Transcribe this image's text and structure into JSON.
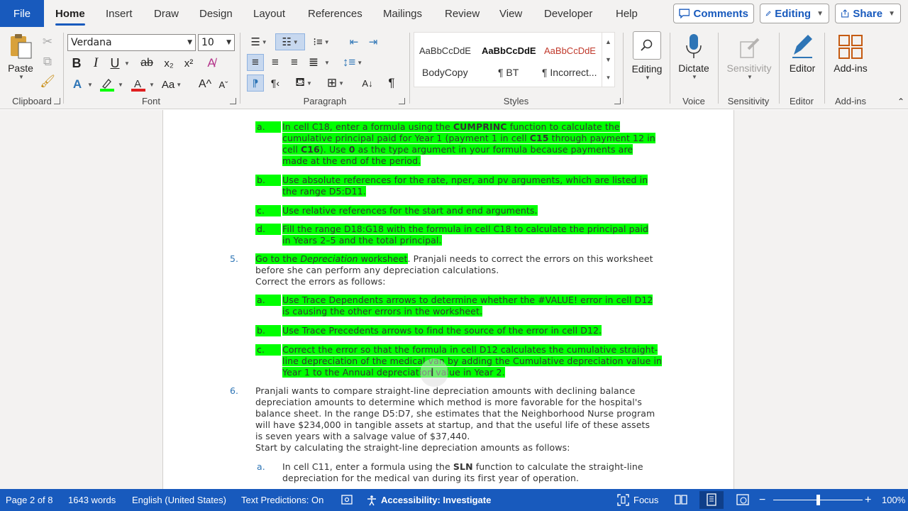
{
  "tabs": {
    "file": "File",
    "items": [
      "Home",
      "Insert",
      "Draw",
      "Design",
      "Layout",
      "References",
      "Mailings",
      "Review",
      "View",
      "Developer",
      "Help"
    ],
    "active": "Home"
  },
  "top_buttons": {
    "comments": "Comments",
    "editing": "Editing",
    "share": "Share"
  },
  "ribbon": {
    "clipboard": {
      "label": "Clipboard",
      "paste": "Paste"
    },
    "font": {
      "label": "Font",
      "name": "Verdana",
      "size": "10",
      "bold": "B",
      "italic": "I",
      "underline": "U",
      "strike": "ab",
      "sub": "x₂",
      "sup": "x²",
      "grow": "A^",
      "shrink": "Aa"
    },
    "paragraph": {
      "label": "Paragraph"
    },
    "styles": {
      "label": "Styles",
      "items": [
        {
          "preview": "AaBbCcDdE",
          "name": "BodyCopy"
        },
        {
          "preview": "AaBbCcDdE",
          "name": "¶ BT"
        },
        {
          "preview": "AaBbCcDdE",
          "name": "¶ Incorrect..."
        }
      ]
    },
    "editing": {
      "label": "Editing"
    },
    "voice": {
      "label": "Voice",
      "button": "Dictate"
    },
    "sensitivity": {
      "label": "Sensitivity",
      "button": "Sensitivity"
    },
    "editor": {
      "label": "Editor",
      "button": "Editor"
    },
    "addins": {
      "label": "Add-ins",
      "button": "Add-ins"
    }
  },
  "document": {
    "step4_items": [
      {
        "marker": "a.",
        "lines": [
          "In cell C18, enter a formula using the CUMPRINC function to calculate the",
          "cumulative principal paid for Year 1 (payment 1 in cell C15 through payment 12 in",
          "cell C16). Use 0 as the type argument in your formula because payments are",
          "made at the end of the period."
        ]
      },
      {
        "marker": "b.",
        "lines": [
          "Use absolute references for the rate, nper, and pv arguments, which are listed in",
          "the range D5:D11."
        ]
      },
      {
        "marker": "c.",
        "lines": [
          "Use relative references for the start and end arguments."
        ]
      },
      {
        "marker": "d.",
        "lines": [
          "Fill the range D18:G18 with the formula in cell C18 to calculate the principal paid",
          "in Years 2–5 and the total principal."
        ]
      }
    ],
    "step5": {
      "number": "5.",
      "hl_prefix": "Go to the ",
      "hl_italic": "Depreciation",
      "hl_suffix": " worksheet",
      "line1_rest": ". Pranjali needs to correct the errors on this worksheet",
      "line2": "before she can perform any depreciation calculations.",
      "line3": "Correct the errors as follows:",
      "items": [
        {
          "marker": "a.",
          "lines": [
            "Use Trace Dependents arrows to determine whether the #VALUE! error in cell D12",
            "is causing the other errors in the worksheet."
          ]
        },
        {
          "marker": "b.",
          "lines": [
            "Use Trace Precedents arrows to find the source of the error in cell D12."
          ]
        },
        {
          "marker": "c.",
          "lines": [
            "Correct the error so that the formula in cell D12 calculates the cumulative straight-",
            "line depreciation of the medical van by adding the Cumulative depreciation value in",
            "Year 1 to the Annual depreciation value in Year 2."
          ]
        }
      ]
    },
    "step6": {
      "number": "6.",
      "lines": [
        "Pranjali wants to compare straight-line depreciation amounts with declining balance",
        "depreciation amounts to determine which method is more favorable for the hospital's",
        "balance sheet. In the range D5:D7, she estimates that the Neighborhood Nurse program",
        "will have $234,000 in tangible assets at startup, and that the useful life of these assets",
        "is seven years with a salvage value of $37,440.",
        "Start by calculating the straight-line depreciation amounts as follows:"
      ],
      "item_a": {
        "marker": "a.",
        "lines": [
          "In cell C11, enter a formula using the SLN function to calculate the straight-line",
          "depreciation for the medical van during its first year of operation."
        ]
      }
    }
  },
  "status": {
    "page": "Page 2 of 8",
    "words": "1643 words",
    "language": "English (United States)",
    "predictions": "Text Predictions: On",
    "accessibility": "Accessibility: Investigate",
    "focus": "Focus",
    "zoom": "100%",
    "zoom_fraction": 0.5
  },
  "colors": {
    "accent": "#185abd",
    "highlight": "#00ff00",
    "list_marker": "#2e75b6"
  }
}
